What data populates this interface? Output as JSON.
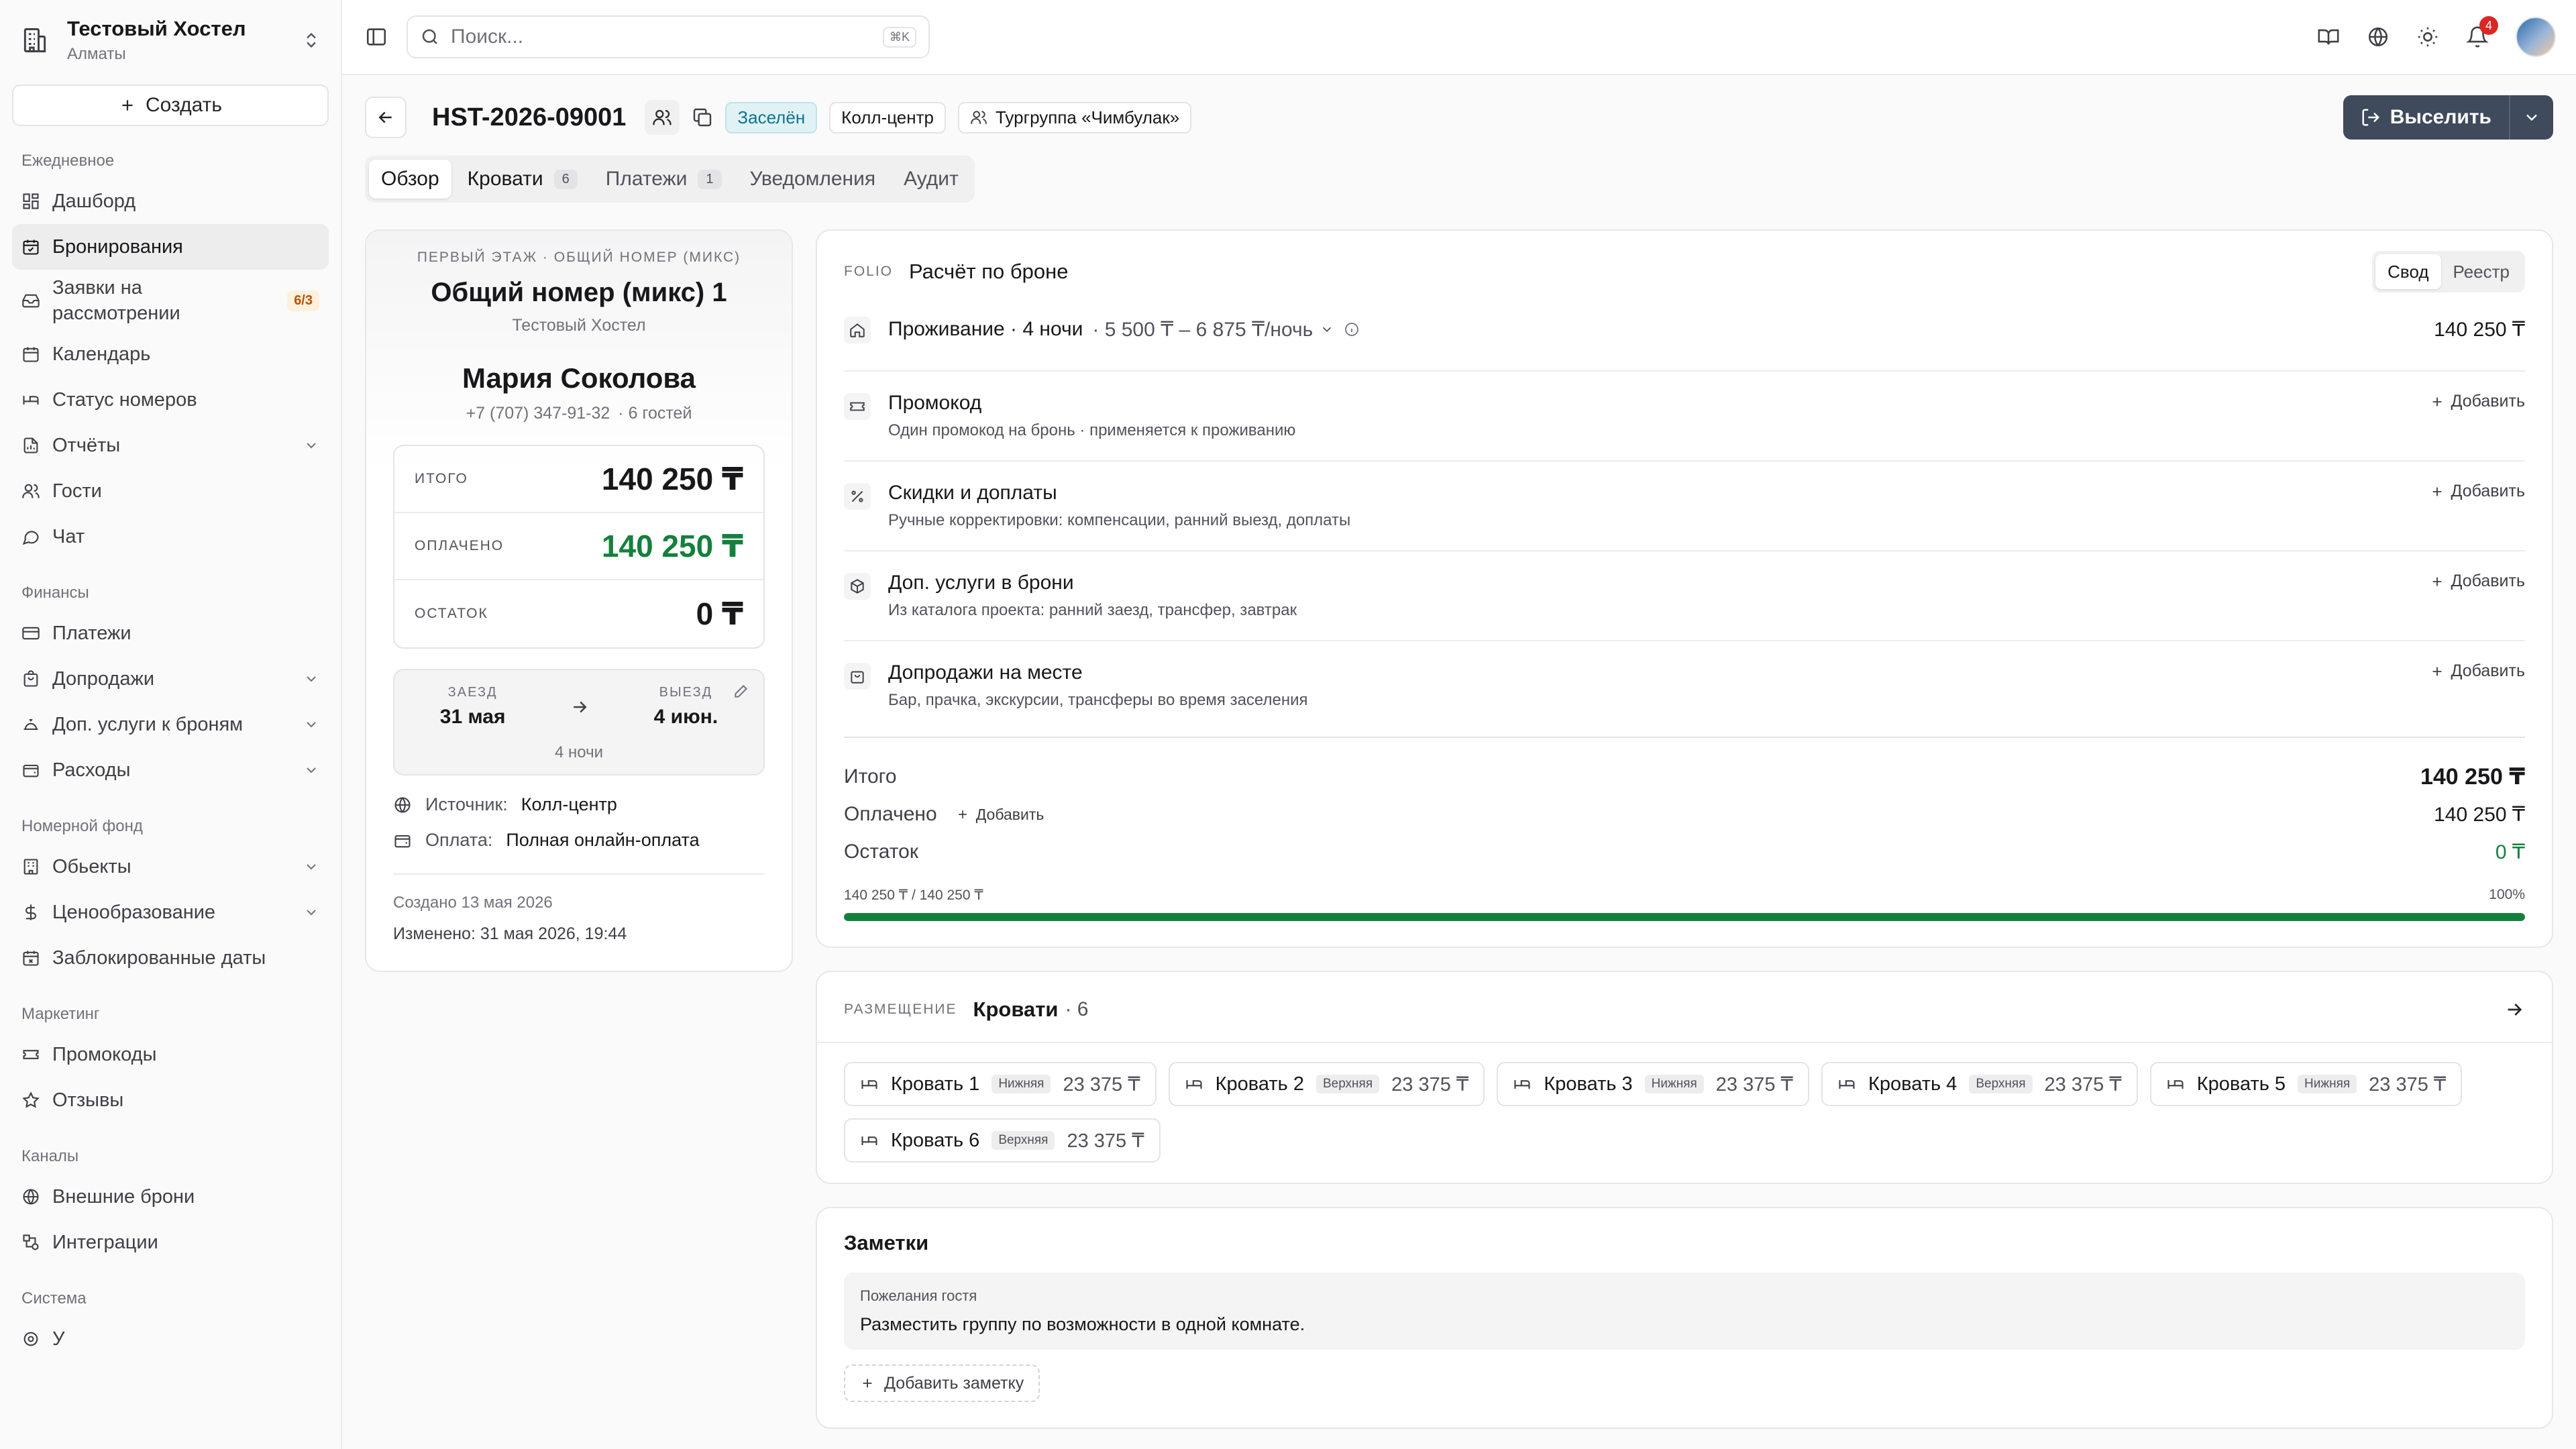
{
  "hostel": {
    "name": "Тестовый Хостел",
    "city": "Алматы"
  },
  "sidebar": {
    "create_label": "Создать",
    "groups": [
      {
        "title": "Ежедневное",
        "items": [
          {
            "label": "Дашборд"
          },
          {
            "label": "Бронирования"
          },
          {
            "label": "Заявки на рассмотрении",
            "badge": "6/3"
          },
          {
            "label": "Календарь"
          },
          {
            "label": "Статус номеров"
          },
          {
            "label": "Отчёты"
          },
          {
            "label": "Гости"
          },
          {
            "label": "Чат"
          }
        ]
      },
      {
        "title": "Финансы",
        "items": [
          {
            "label": "Платежи"
          },
          {
            "label": "Допродажи"
          },
          {
            "label": "Доп. услуги к броням"
          },
          {
            "label": "Расходы"
          }
        ]
      },
      {
        "title": "Номерной фонд",
        "items": [
          {
            "label": "Обьекты"
          },
          {
            "label": "Ценообразование"
          },
          {
            "label": "Заблокированные даты"
          }
        ]
      },
      {
        "title": "Маркетинг",
        "items": [
          {
            "label": "Промокоды"
          },
          {
            "label": "Отзывы"
          }
        ]
      },
      {
        "title": "Каналы",
        "items": [
          {
            "label": "Внешние брони"
          },
          {
            "label": "Интеграции"
          }
        ]
      },
      {
        "title": "Система",
        "items": [
          {
            "label": "У"
          }
        ]
      }
    ]
  },
  "topbar": {
    "search_placeholder": "Поиск...",
    "search_shortcut": "⌘K",
    "notification_count": "4"
  },
  "booking": {
    "id": "HST-2026-09001",
    "status": "Заселён",
    "channel": "Колл-центр",
    "group": "Тургруппа «Чимбулак»",
    "checkout_label": "Выселить"
  },
  "tabs": [
    {
      "label": "Обзор"
    },
    {
      "label": "Кровати",
      "count": "6"
    },
    {
      "label": "Платежи",
      "count": "1"
    },
    {
      "label": "Уведомления"
    },
    {
      "label": "Аудит"
    }
  ],
  "summary_card": {
    "room_category": "ПЕРВЫЙ ЭТАЖ · ОБЩИЙ НОМЕР (МИКС)",
    "room_name": "Общий номер (микс) 1",
    "hostel": "Тестовый Хостел",
    "guest_name": "Мария Соколова",
    "guest_phone": "+7 (707) 347-91-32",
    "guest_count": "· 6 гостей",
    "total_label": "ИТОГО",
    "total": "140 250 ₸",
    "paid_label": "ОПЛАЧЕНО",
    "paid": "140 250 ₸",
    "balance_label": "ОСТАТОК",
    "balance": "0 ₸",
    "checkin_label": "ЗАЕЗД",
    "checkin": "31 мая",
    "checkout_label": "ВЫЕЗД",
    "checkout": "4 июн.",
    "nights": "4 ночи",
    "source_label": "Источник:",
    "source": "Колл-центр",
    "payment_label": "Оплата:",
    "payment": "Полная онлайн-оплата",
    "created": "Создано 13 мая 2026",
    "modified": "Изменено: 31 мая 2026, 19:44"
  },
  "folio": {
    "mini_label": "FOLIO",
    "title": "Расчёт по броне",
    "view_summary": "Свод",
    "view_registry": "Реестр",
    "stay_title": "Проживание · 4 ночи",
    "stay_range": "· 5 500 ₸ – 6 875 ₸/ночь",
    "stay_amount": "140 250 ₸",
    "add_label": "Добавить",
    "rows": [
      {
        "title": "Промокод",
        "sub": "Один промокод на бронь · применяется к проживанию"
      },
      {
        "title": "Скидки и доплаты",
        "sub": "Ручные корректировки: компенсации, ранний выезд, доплаты"
      },
      {
        "title": "Доп. услуги в брони",
        "sub": "Из каталога проекта: ранний заезд, трансфер, завтрак"
      },
      {
        "title": "Допродажи на месте",
        "sub": "Бар, прачка, экскурсии, трансферы во время заселения"
      }
    ],
    "total_label": "Итого",
    "total": "140 250 ₸",
    "paid_label": "Оплачено",
    "paid": "140 250 ₸",
    "balance_label": "Остаток",
    "balance": "0 ₸",
    "progress_text": "140 250 ₸ / 140 250 ₸",
    "progress_percent": "100%",
    "progress_fraction": 1.0
  },
  "beds": {
    "mini_label": "РАЗМЕЩЕНИЕ",
    "title": "Кровати",
    "count": "· 6",
    "items": [
      {
        "name": "Кровать 1",
        "tier": "Нижняя",
        "price": "23 375 ₸"
      },
      {
        "name": "Кровать 2",
        "tier": "Верхняя",
        "price": "23 375 ₸"
      },
      {
        "name": "Кровать 3",
        "tier": "Нижняя",
        "price": "23 375 ₸"
      },
      {
        "name": "Кровать 4",
        "tier": "Верхняя",
        "price": "23 375 ₸"
      },
      {
        "name": "Кровать 5",
        "tier": "Нижняя",
        "price": "23 375 ₸"
      },
      {
        "name": "Кровать 6",
        "tier": "Верхняя",
        "price": "23 375 ₸"
      }
    ]
  },
  "notes": {
    "title": "Заметки",
    "guest_wishes_label": "Пожелания гостя",
    "guest_wishes": "Разместить группу по возможности в одной комнате.",
    "add_note_label": "Добавить заметку"
  },
  "colors": {
    "accent_green": "#15803d",
    "status_teal": "#0e7490",
    "primary_button": "#3f4a5c",
    "badge_orange": "#b45309",
    "notification_red": "#dc2626"
  }
}
